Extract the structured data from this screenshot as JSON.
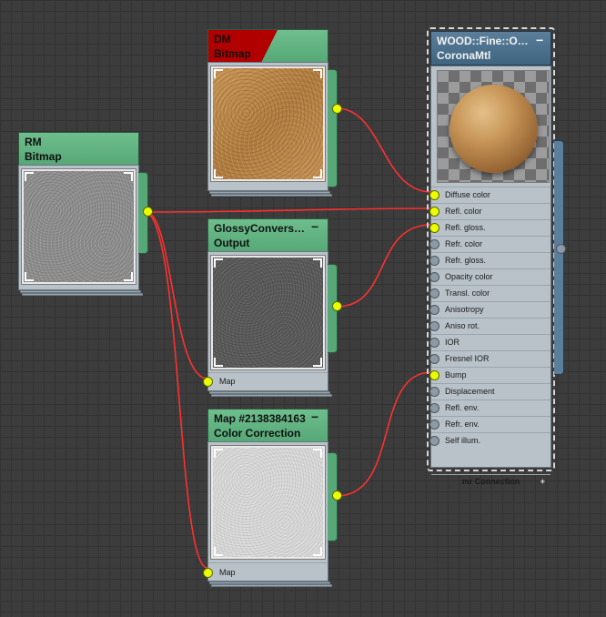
{
  "nodes": {
    "dm": {
      "title": "DM",
      "subtitle": "Bitmap",
      "thumb": "wood-texture"
    },
    "rm": {
      "title": "RM",
      "subtitle": "Bitmap",
      "thumb": "gray-noise-texture"
    },
    "glossy": {
      "title": "GlossyConvers…",
      "subtitle": "Output",
      "thumb": "dark-gray-noise-texture",
      "input_label": "Map"
    },
    "cc": {
      "title": "Map #2138384163",
      "subtitle": "Color Correction",
      "thumb": "light-gray-noise-texture",
      "input_label": "Map"
    },
    "material": {
      "title": "WOOD::Fine::O…",
      "subtitle": "CoronaMtl",
      "thumb": "wood-sphere-preview",
      "slots": [
        {
          "label": "Diffuse color",
          "connected": true
        },
        {
          "label": "Refl. color",
          "connected": true
        },
        {
          "label": "Refl. gloss.",
          "connected": true
        },
        {
          "label": "Refr. color",
          "connected": false
        },
        {
          "label": "Refr. gloss.",
          "connected": false
        },
        {
          "label": "Opacity color",
          "connected": false
        },
        {
          "label": "Transl. color",
          "connected": false
        },
        {
          "label": "Anisotropy",
          "connected": false
        },
        {
          "label": "Aniso rot.",
          "connected": false
        },
        {
          "label": "IOR",
          "connected": false
        },
        {
          "label": "Fresnel IOR",
          "connected": false
        },
        {
          "label": "Bump",
          "connected": true
        },
        {
          "label": "Displacement",
          "connected": false
        },
        {
          "label": "Refl. env.",
          "connected": false
        },
        {
          "label": "Refr. env.",
          "connected": false
        },
        {
          "label": "Self illum.",
          "connected": false
        }
      ],
      "footer_label": "mr Connection"
    }
  },
  "colors": {
    "header_green": "#56a876",
    "header_blue": "#4a6f8a",
    "wire_red": "#ff3030",
    "socket_live": "#eaff00"
  },
  "icons": {
    "minimize": "minimize-icon",
    "plus": "plus-icon"
  }
}
